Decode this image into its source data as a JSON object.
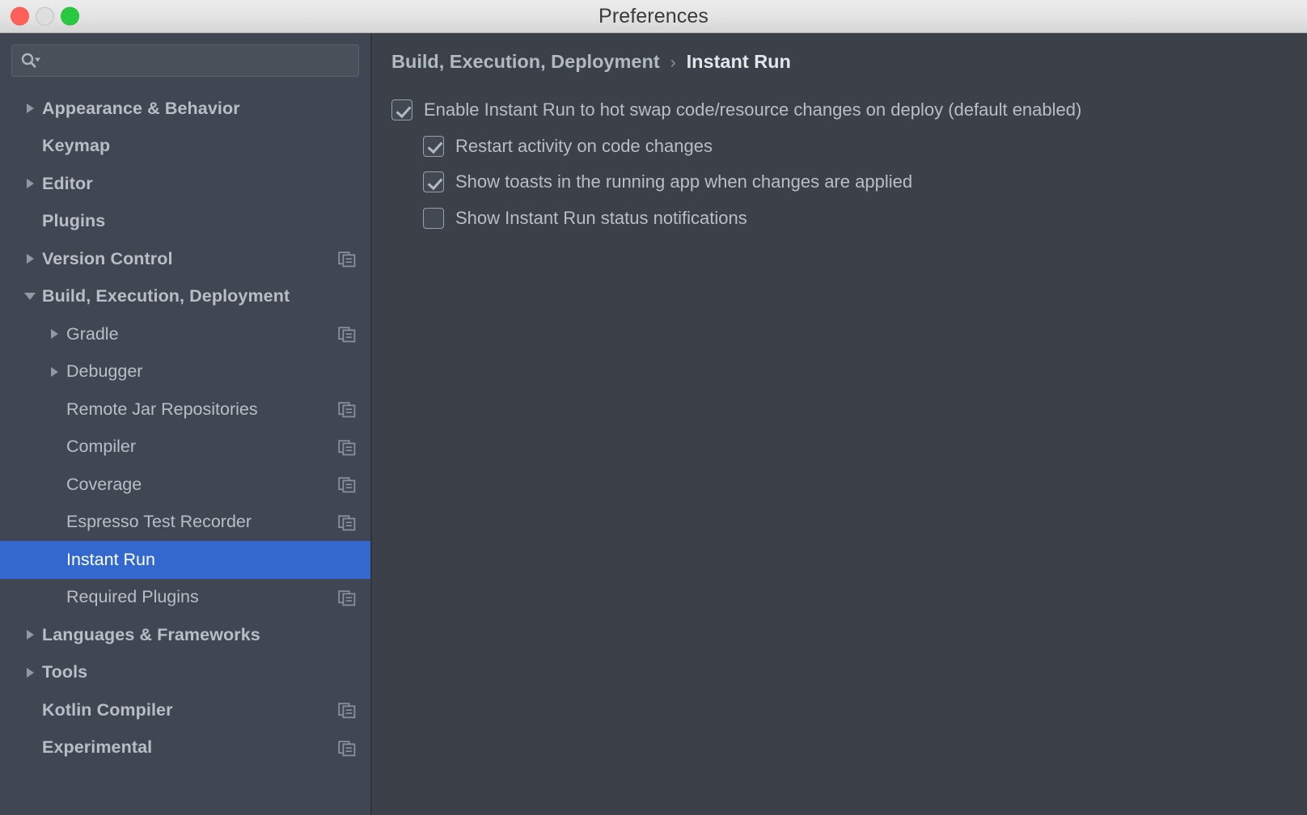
{
  "window": {
    "title": "Preferences",
    "traffic_lights": [
      {
        "name": "close",
        "color": "#ff6058"
      },
      {
        "name": "minimize",
        "color": "#dedede"
      },
      {
        "name": "zoom",
        "color": "#28c840"
      }
    ]
  },
  "search": {
    "value": "",
    "placeholder": "",
    "icon": "search-icon"
  },
  "sidebar": {
    "items": [
      {
        "label": "Appearance & Behavior",
        "level": 0,
        "arrow": "right",
        "copy_icon": false,
        "selected": false
      },
      {
        "label": "Keymap",
        "level": 0,
        "arrow": "none",
        "copy_icon": false,
        "selected": false
      },
      {
        "label": "Editor",
        "level": 0,
        "arrow": "right",
        "copy_icon": false,
        "selected": false
      },
      {
        "label": "Plugins",
        "level": 0,
        "arrow": "none",
        "copy_icon": false,
        "selected": false
      },
      {
        "label": "Version Control",
        "level": 0,
        "arrow": "right",
        "copy_icon": true,
        "selected": false
      },
      {
        "label": "Build, Execution, Deployment",
        "level": 0,
        "arrow": "down",
        "copy_icon": false,
        "selected": false
      },
      {
        "label": "Gradle",
        "level": 1,
        "arrow": "right",
        "copy_icon": true,
        "selected": false
      },
      {
        "label": "Debugger",
        "level": 1,
        "arrow": "right",
        "copy_icon": false,
        "selected": false
      },
      {
        "label": "Remote Jar Repositories",
        "level": 1,
        "arrow": "none",
        "copy_icon": true,
        "selected": false
      },
      {
        "label": "Compiler",
        "level": 1,
        "arrow": "none",
        "copy_icon": true,
        "selected": false
      },
      {
        "label": "Coverage",
        "level": 1,
        "arrow": "none",
        "copy_icon": true,
        "selected": false
      },
      {
        "label": "Espresso Test Recorder",
        "level": 1,
        "arrow": "none",
        "copy_icon": true,
        "selected": false
      },
      {
        "label": "Instant Run",
        "level": 1,
        "arrow": "none",
        "copy_icon": false,
        "selected": true
      },
      {
        "label": "Required Plugins",
        "level": 1,
        "arrow": "none",
        "copy_icon": true,
        "selected": false
      },
      {
        "label": "Languages & Frameworks",
        "level": 0,
        "arrow": "right",
        "copy_icon": false,
        "selected": false
      },
      {
        "label": "Tools",
        "level": 0,
        "arrow": "right",
        "copy_icon": false,
        "selected": false
      },
      {
        "label": "Kotlin Compiler",
        "level": 0,
        "arrow": "none",
        "copy_icon": true,
        "selected": false
      },
      {
        "label": "Experimental",
        "level": 0,
        "arrow": "none",
        "copy_icon": true,
        "selected": false
      }
    ],
    "selection_color": "#3369ce"
  },
  "panel": {
    "breadcrumb": {
      "parent": "Build, Execution, Deployment",
      "separator": "›",
      "current": "Instant Run"
    },
    "options": [
      {
        "label": "Enable Instant Run to hot swap code/resource changes on deploy (default enabled)",
        "checked": true,
        "indent": false
      },
      {
        "label": "Restart activity on code changes",
        "checked": true,
        "indent": true
      },
      {
        "label": "Show toasts in the running app when changes are applied",
        "checked": true,
        "indent": true
      },
      {
        "label": "Show Instant Run status notifications",
        "checked": false,
        "indent": true
      }
    ]
  }
}
